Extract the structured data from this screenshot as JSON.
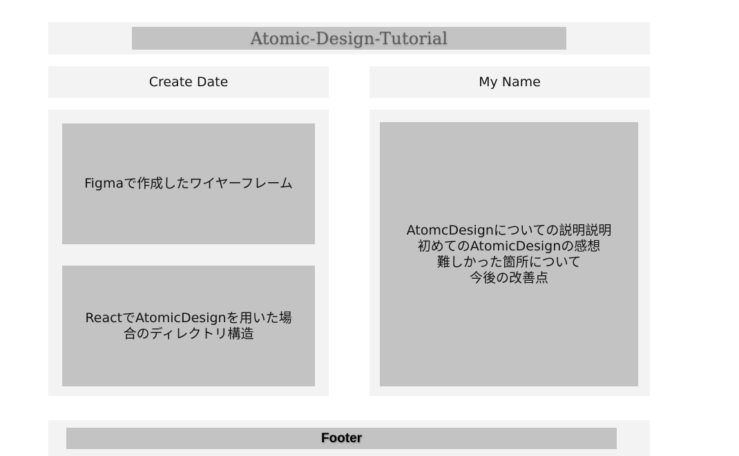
{
  "header": {
    "title": "Atomic-Design-Tutorial"
  },
  "info": {
    "create_date": "Create Date",
    "my_name": "My Name"
  },
  "left_panel": {
    "figma_block": {
      "lines": [
        "Figmaで作成したワイヤーフレーム"
      ]
    },
    "react_block": {
      "lines": [
        "ReactでAtomicDesignを用いた場",
        "合のディレクトリ構造"
      ]
    }
  },
  "right_panel": {
    "summary_block": {
      "lines": [
        "AtomcDesignについての説明説明",
        "初めてのAtomicDesignの感想",
        "難しかった箇所について",
        "今後の改善点"
      ]
    }
  },
  "footer": {
    "label": "Footer"
  },
  "colors": {
    "panel_background": "#f3f3f3",
    "block_background": "#c3c3c3",
    "title_text": "#5a5a5a"
  }
}
